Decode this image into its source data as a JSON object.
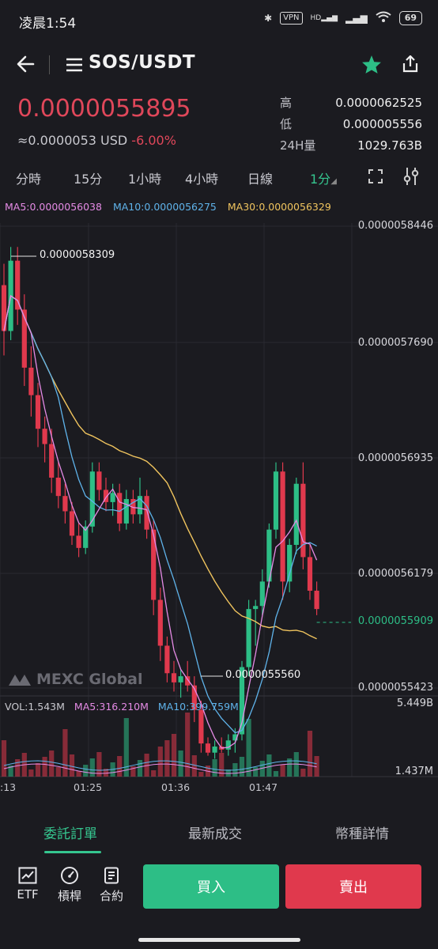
{
  "status_bar": {
    "time": "凌晨1:54",
    "vpn": "VPN",
    "hd": "HD",
    "battery": "69"
  },
  "header": {
    "pair": "SOS/USDT"
  },
  "price": {
    "last": "0.0000055895",
    "usd": "≈0.0000053 USD",
    "change": "-6.00%",
    "high_label": "高",
    "high": "0.0000062525",
    "low_label": "低",
    "low": "0.000005556",
    "vol_label": "24H量",
    "vol": "1029.763B"
  },
  "intervals": [
    "分時",
    "15分",
    "1小時",
    "4小時",
    "日線",
    "1分"
  ],
  "active_interval": "1分",
  "ma": {
    "ma5": "MA5:0.0000056038",
    "ma10": "MA10:0.0000056275",
    "ma30": "MA30:0.0000056329"
  },
  "volume": {
    "vol": "VOL:1.543M",
    "ma5": "MA5:316.210M",
    "ma10": "MA10:399.759M",
    "axis_top": "5.449B",
    "axis_bottom": "1.437M"
  },
  "watermark": "MEXC Global",
  "colors": {
    "up": "#2dbe86",
    "down": "#e0394d",
    "ma5": "#e58be5",
    "ma10": "#5fb3ea",
    "ma30": "#f0c45e"
  },
  "chart_data": {
    "type": "candlestick",
    "price_axis_labels": [
      "0.0000058446",
      "0.0000057690",
      "0.0000056935",
      "0.0000056179",
      "0.0000055423"
    ],
    "current_price_label": "0.0000055909",
    "high_marker": "0.0000058309",
    "low_marker": "0.0000055560",
    "time_labels": [
      ":13",
      "01:25",
      "01:36",
      "01:47"
    ],
    "ylim": [
      5.5423e-06,
      5.8446e-06
    ],
    "candles": [
      {
        "o": 5.806,
        "h": 5.82,
        "l": 5.76,
        "c": 5.776
      },
      {
        "o": 5.776,
        "h": 5.831,
        "l": 5.77,
        "c": 5.822
      },
      {
        "o": 5.822,
        "h": 5.831,
        "l": 5.78,
        "c": 5.79
      },
      {
        "o": 5.79,
        "h": 5.8,
        "l": 5.74,
        "c": 5.752
      },
      {
        "o": 5.752,
        "h": 5.766,
        "l": 5.72,
        "c": 5.734
      },
      {
        "o": 5.734,
        "h": 5.742,
        "l": 5.7,
        "c": 5.712
      },
      {
        "o": 5.712,
        "h": 5.72,
        "l": 5.69,
        "c": 5.702
      },
      {
        "o": 5.702,
        "h": 5.712,
        "l": 5.67,
        "c": 5.68
      },
      {
        "o": 5.68,
        "h": 5.69,
        "l": 5.66,
        "c": 5.668
      },
      {
        "o": 5.668,
        "h": 5.676,
        "l": 5.65,
        "c": 5.658
      },
      {
        "o": 5.658,
        "h": 5.664,
        "l": 5.636,
        "c": 5.642
      },
      {
        "o": 5.642,
        "h": 5.65,
        "l": 5.628,
        "c": 5.634
      },
      {
        "o": 5.634,
        "h": 5.652,
        "l": 5.63,
        "c": 5.648
      },
      {
        "o": 5.648,
        "h": 5.69,
        "l": 5.644,
        "c": 5.684
      },
      {
        "o": 5.684,
        "h": 5.69,
        "l": 5.665,
        "c": 5.672
      },
      {
        "o": 5.672,
        "h": 5.68,
        "l": 5.658,
        "c": 5.664
      },
      {
        "o": 5.664,
        "h": 5.676,
        "l": 5.655,
        "c": 5.67
      },
      {
        "o": 5.67,
        "h": 5.676,
        "l": 5.645,
        "c": 5.65
      },
      {
        "o": 5.65,
        "h": 5.672,
        "l": 5.646,
        "c": 5.666
      },
      {
        "o": 5.666,
        "h": 5.672,
        "l": 5.65,
        "c": 5.656
      },
      {
        "o": 5.656,
        "h": 5.68,
        "l": 5.65,
        "c": 5.668
      },
      {
        "o": 5.668,
        "h": 5.672,
        "l": 5.64,
        "c": 5.646
      },
      {
        "o": 5.646,
        "h": 5.652,
        "l": 5.59,
        "c": 5.6
      },
      {
        "o": 5.6,
        "h": 5.608,
        "l": 5.56,
        "c": 5.57
      },
      {
        "o": 5.57,
        "h": 5.576,
        "l": 5.546,
        "c": 5.552
      },
      {
        "o": 5.552,
        "h": 5.56,
        "l": 5.54,
        "c": 5.546
      },
      {
        "o": 5.546,
        "h": 5.554,
        "l": 5.536,
        "c": 5.55
      },
      {
        "o": 5.55,
        "h": 5.56,
        "l": 5.54,
        "c": 5.544
      },
      {
        "o": 5.544,
        "h": 5.55,
        "l": 5.52,
        "c": 5.528
      },
      {
        "o": 5.528,
        "h": 5.534,
        "l": 5.5,
        "c": 5.506
      },
      {
        "o": 5.506,
        "h": 5.51,
        "l": 5.498,
        "c": 5.5
      },
      {
        "o": 5.5,
        "h": 5.508,
        "l": 5.496,
        "c": 5.504
      },
      {
        "o": 5.504,
        "h": 5.51,
        "l": 5.5,
        "c": 5.502
      },
      {
        "o": 5.502,
        "h": 5.512,
        "l": 5.498,
        "c": 5.508
      },
      {
        "o": 5.508,
        "h": 5.516,
        "l": 5.5,
        "c": 5.512
      },
      {
        "o": 5.512,
        "h": 5.56,
        "l": 5.508,
        "c": 5.556
      },
      {
        "o": 5.556,
        "h": 5.6,
        "l": 5.55,
        "c": 5.594
      },
      {
        "o": 5.594,
        "h": 5.6,
        "l": 5.57,
        "c": 5.596
      },
      {
        "o": 5.596,
        "h": 5.62,
        "l": 5.59,
        "c": 5.612
      },
      {
        "o": 5.612,
        "h": 5.65,
        "l": 5.608,
        "c": 5.646
      },
      {
        "o": 5.646,
        "h": 5.69,
        "l": 5.64,
        "c": 5.684
      },
      {
        "o": 5.684,
        "h": 5.69,
        "l": 5.6,
        "c": 5.612
      },
      {
        "o": 5.612,
        "h": 5.64,
        "l": 5.605,
        "c": 5.636
      },
      {
        "o": 5.636,
        "h": 5.68,
        "l": 5.63,
        "c": 5.676
      },
      {
        "o": 5.676,
        "h": 5.69,
        "l": 5.62,
        "c": 5.628
      },
      {
        "o": 5.628,
        "h": 5.636,
        "l": 5.6,
        "c": 5.606
      },
      {
        "o": 5.606,
        "h": 5.612,
        "l": 5.59,
        "c": 5.594
      }
    ]
  },
  "bottom_tabs": [
    "委託訂單",
    "最新成交",
    "幣種詳情"
  ],
  "actions": {
    "etf": "ETF",
    "leverage": "槓桿",
    "contract": "合約",
    "buy": "買入",
    "sell": "賣出"
  }
}
